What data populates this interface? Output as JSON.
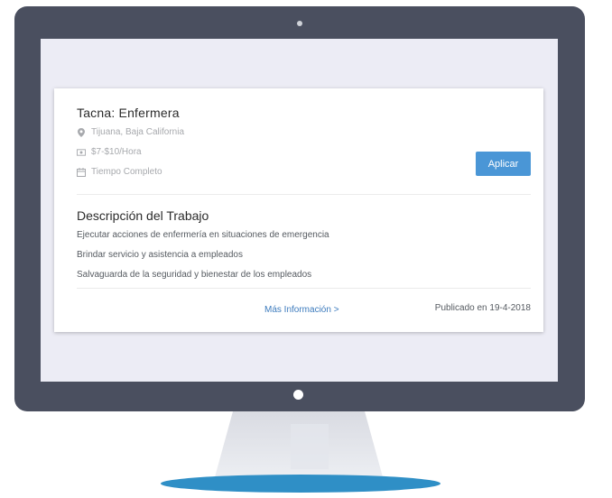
{
  "job": {
    "title": "Tacna: Enfermera",
    "location": "Tijuana, Baja California",
    "salary": "$7-$10/Hora",
    "schedule": "Tiempo Completo",
    "apply_label": "Aplicar"
  },
  "description": {
    "heading": "Descripción del Trabajo",
    "items": [
      "Ejecutar acciones de enfermería en situaciones de emergencia",
      "Brindar servicio y asistencia a empleados",
      "Salvaguarda de la seguridad y bienestar de los empleados"
    ]
  },
  "footer": {
    "more_info": "Más Información >",
    "published": "Publicado en 19-4-2018"
  },
  "icons": {
    "location": "map-marker-icon",
    "salary": "money-icon",
    "schedule": "calendar-icon"
  },
  "colors": {
    "accent": "#4a96d6",
    "link": "#3c7bbd",
    "monitor_frame": "#4a4f5f",
    "monitor_base": "#2f8fc6"
  }
}
